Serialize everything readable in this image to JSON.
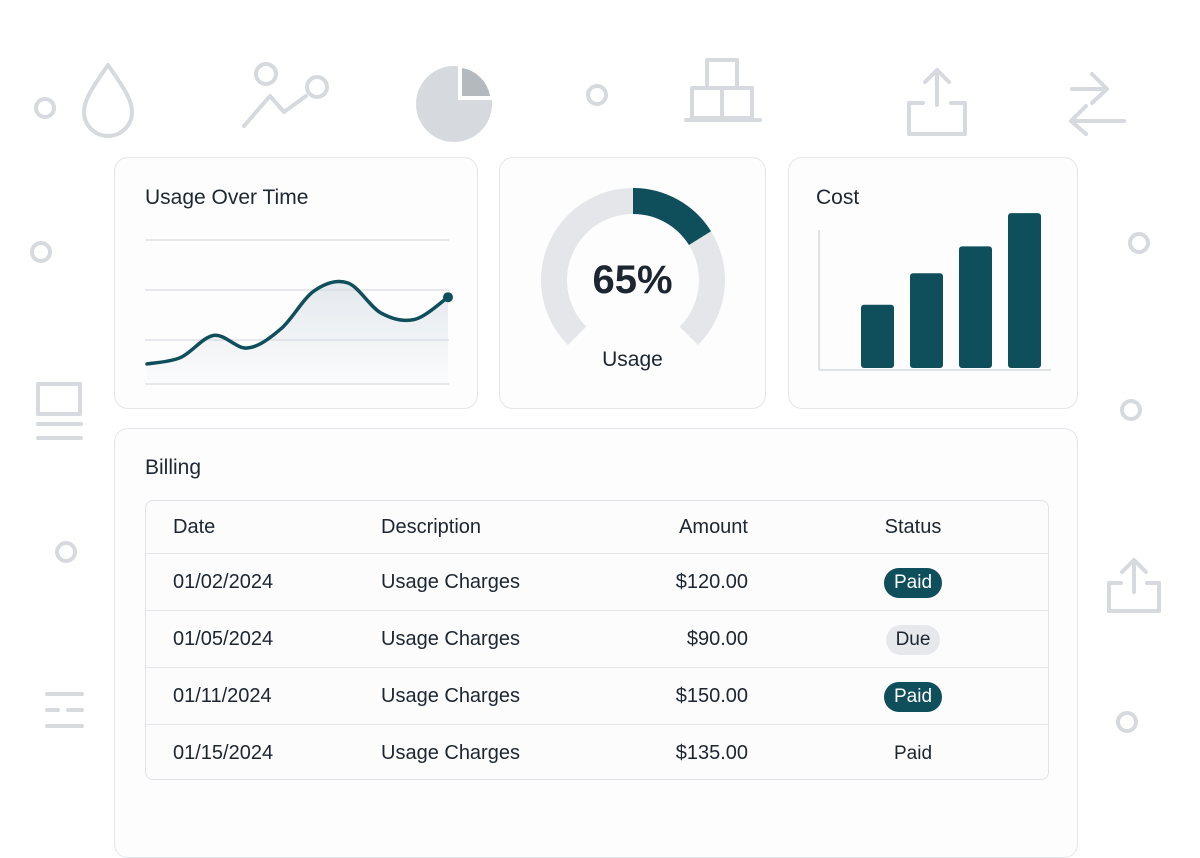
{
  "colors": {
    "accent": "#0e4f5b",
    "muted": "#e6e8eb",
    "icon_gray": "#d6d9dd"
  },
  "background_icons": [
    "water-drop-icon",
    "line-chart-icon",
    "pie-chart-icon",
    "boxes-icon",
    "upload-icon",
    "swap-arrows-icon",
    "list-icon",
    "filter-icon",
    "share-icon"
  ],
  "usage_card": {
    "title": "Usage Over Time"
  },
  "gauge_card": {
    "value": "65%",
    "label": "Usage",
    "fraction": 0.65
  },
  "cost_card": {
    "title": "Cost"
  },
  "chart_data": [
    {
      "type": "line",
      "title": "Usage Over Time",
      "x": [
        1,
        2,
        3,
        4,
        5,
        6,
        7,
        8,
        9,
        10
      ],
      "values": [
        1.2,
        1.6,
        3.0,
        2.2,
        3.4,
        5.8,
        6.3,
        4.4,
        4.0,
        5.4
      ],
      "ylim": [
        0,
        9
      ],
      "grid": true
    },
    {
      "type": "bar",
      "title": "Cost",
      "categories": [
        "1",
        "2",
        "3",
        "4"
      ],
      "values": [
        40,
        60,
        77,
        98
      ],
      "ylim": [
        0,
        100
      ]
    }
  ],
  "billing": {
    "title": "Billing",
    "columns": [
      "Date",
      "Description",
      "Amount",
      "Status"
    ],
    "rows": [
      {
        "date": "01/02/2024",
        "description": "Usage Charges",
        "amount": "$120.00",
        "status": "Paid",
        "style": "paid-filled"
      },
      {
        "date": "01/05/2024",
        "description": "Usage Charges",
        "amount": "$90.00",
        "status": "Due",
        "style": "due"
      },
      {
        "date": "01/11/2024",
        "description": "Usage Charges",
        "amount": "$150.00",
        "status": "Paid",
        "style": "paid-filled"
      },
      {
        "date": "01/15/2024",
        "description": "Usage Charges",
        "amount": "$135.00",
        "status": "Paid",
        "style": "plain"
      }
    ]
  }
}
